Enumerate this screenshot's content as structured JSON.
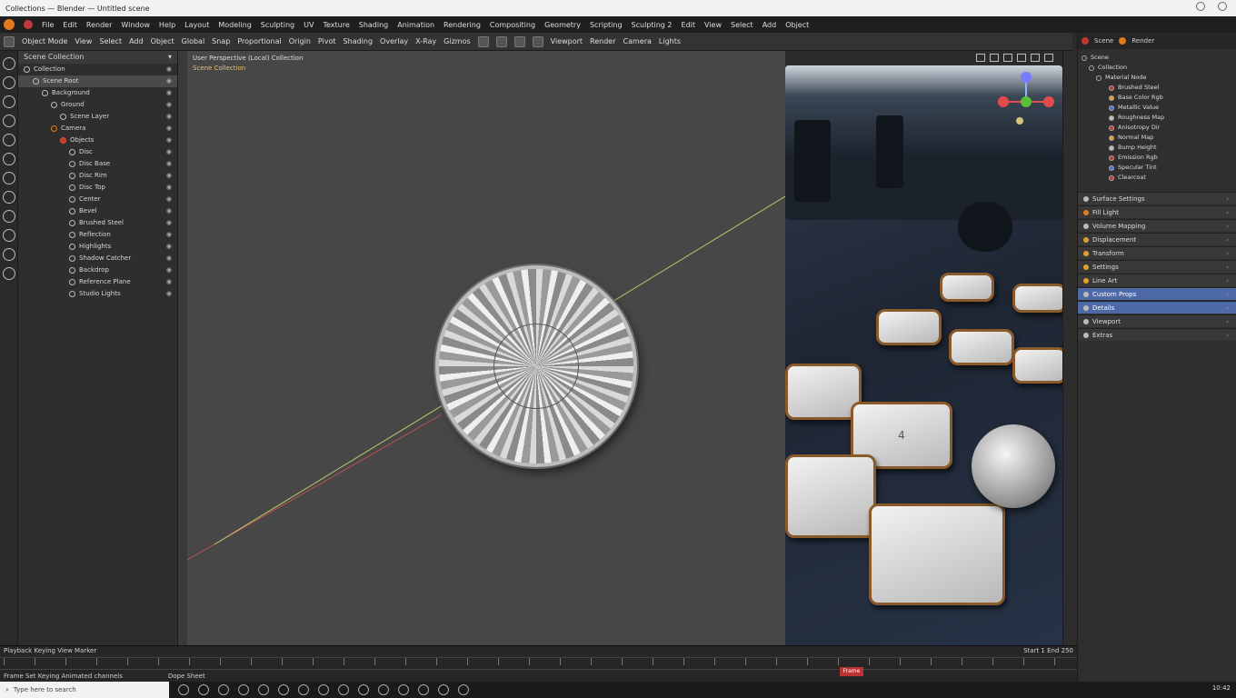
{
  "window": {
    "title": "Collections — Blender — Untitled scene"
  },
  "menu": {
    "items": [
      "File",
      "Edit",
      "Render",
      "Window",
      "Help",
      "Layout",
      "Modeling",
      "Sculpting",
      "UV",
      "Texture",
      "Shading",
      "Animation",
      "Rendering",
      "Compositing",
      "Geometry",
      "Scripting",
      "Sculpting 2",
      "Edit",
      "View",
      "Select",
      "Add",
      "Object"
    ]
  },
  "toolbar": {
    "items": [
      "Object Mode",
      "View",
      "Select",
      "Add",
      "Object",
      "Global",
      "Snap",
      "Proportional",
      "Origin",
      "Pivot",
      "Shading",
      "Overlay",
      "X-Ray",
      "Gizmos",
      "Viewport",
      "Render",
      "Camera",
      "Lights"
    ]
  },
  "outliner": {
    "header": "Scene Collection",
    "rows": [
      {
        "label": "Collection",
        "level": 0,
        "dot": ""
      },
      {
        "label": "Scene Root",
        "level": 1,
        "dot": "",
        "selected": true
      },
      {
        "label": "Background",
        "level": 2,
        "dot": ""
      },
      {
        "label": "Ground",
        "level": 3,
        "dot": ""
      },
      {
        "label": "Scene Layer",
        "level": 4,
        "dot": ""
      },
      {
        "label": "Camera",
        "level": 3,
        "dot": "org"
      },
      {
        "label": "Objects",
        "level": 4,
        "dot": "red"
      },
      {
        "label": "Disc",
        "level": 5,
        "dot": ""
      },
      {
        "label": "Disc Base",
        "level": 5,
        "dot": ""
      },
      {
        "label": "Disc Rim",
        "level": 5,
        "dot": ""
      },
      {
        "label": "Disc Top",
        "level": 5,
        "dot": ""
      },
      {
        "label": "Center",
        "level": 5,
        "dot": ""
      },
      {
        "label": "Bevel",
        "level": 5,
        "dot": ""
      },
      {
        "label": "Brushed Steel",
        "level": 5,
        "dot": ""
      },
      {
        "label": "Reflection",
        "level": 5,
        "dot": ""
      },
      {
        "label": "Highlights",
        "level": 5,
        "dot": ""
      },
      {
        "label": "Shadow Catcher",
        "level": 5,
        "dot": ""
      },
      {
        "label": "Backdrop",
        "level": 5,
        "dot": ""
      },
      {
        "label": "Reference Plane",
        "level": 5,
        "dot": ""
      },
      {
        "label": "Studio Lights",
        "level": 5,
        "dot": ""
      }
    ]
  },
  "viewport": {
    "header_line1": "User Perspective (Local) Collection",
    "header_line2": "Scene Collection"
  },
  "properties": {
    "tabs": [
      "Scene",
      "Render"
    ],
    "tree": [
      {
        "label": "Scene",
        "color": ""
      },
      {
        "label": "Collection",
        "color": ""
      },
      {
        "label": "Material Node",
        "color": ""
      },
      {
        "label": "Brushed Steel",
        "color": "#c0392b"
      },
      {
        "label": "Base Color Rgb",
        "color": "#e0a030"
      },
      {
        "label": "Metallic Value",
        "color": "#3a7bd5"
      },
      {
        "label": "Roughness Map",
        "color": "#bbbbbb"
      },
      {
        "label": "Anisotropy Dir",
        "color": "#c0392b"
      },
      {
        "label": "Normal Map",
        "color": "#e0a030"
      },
      {
        "label": "Bump Height",
        "color": "#bbbbbb"
      },
      {
        "label": "Emission Rgb",
        "color": "#c0392b"
      },
      {
        "label": "Specular Tint",
        "color": "#3a7bd5"
      },
      {
        "label": "Clearcoat",
        "color": "#c0392b"
      }
    ],
    "sections": [
      {
        "label": "Surface Settings",
        "color": "#bbbbbb",
        "highlight": false
      },
      {
        "label": "Fill Light",
        "color": "#e07a1f",
        "highlight": false
      },
      {
        "label": "Volume Mapping",
        "color": "#bbbbbb",
        "highlight": false
      },
      {
        "label": "Displacement",
        "color": "#e0a030",
        "highlight": false
      },
      {
        "label": "Transform",
        "color": "#e0a030",
        "highlight": false
      },
      {
        "label": "Settings",
        "color": "#e0a030",
        "highlight": false
      },
      {
        "label": "Line Art",
        "color": "#e0a030",
        "highlight": false
      },
      {
        "label": "Custom Props",
        "color": "#bbbbbb",
        "highlight": true
      },
      {
        "label": "Details",
        "color": "#bbbbbb",
        "highlight": true
      },
      {
        "label": "Viewport",
        "color": "#bbbbbb",
        "highlight": false
      },
      {
        "label": "Extras",
        "color": "#bbbbbb",
        "highlight": false
      }
    ]
  },
  "timeline": {
    "left_label": "Playback Keying View Marker",
    "right_label": "Start 1 End 250",
    "bottom_left": "Frame Set Keying  Animated channels",
    "bottom_mid": "Dope Sheet",
    "current_frame": "Frame"
  },
  "taskbar": {
    "search_placeholder": "Type here to search",
    "time": "10:42"
  }
}
